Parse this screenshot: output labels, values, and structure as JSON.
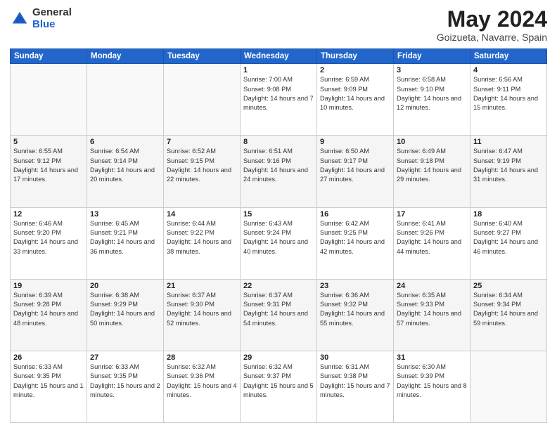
{
  "header": {
    "logo": {
      "general": "General",
      "blue": "Blue"
    },
    "title": "May 2024",
    "subtitle": "Goizueta, Navarre, Spain"
  },
  "weekdays": [
    "Sunday",
    "Monday",
    "Tuesday",
    "Wednesday",
    "Thursday",
    "Friday",
    "Saturday"
  ],
  "weeks": [
    [
      {
        "day": "",
        "empty": true
      },
      {
        "day": "",
        "empty": true
      },
      {
        "day": "",
        "empty": true
      },
      {
        "day": "1",
        "sunrise": "Sunrise: 7:00 AM",
        "sunset": "Sunset: 9:08 PM",
        "daylight": "Daylight: 14 hours and 7 minutes."
      },
      {
        "day": "2",
        "sunrise": "Sunrise: 6:59 AM",
        "sunset": "Sunset: 9:09 PM",
        "daylight": "Daylight: 14 hours and 10 minutes."
      },
      {
        "day": "3",
        "sunrise": "Sunrise: 6:58 AM",
        "sunset": "Sunset: 9:10 PM",
        "daylight": "Daylight: 14 hours and 12 minutes."
      },
      {
        "day": "4",
        "sunrise": "Sunrise: 6:56 AM",
        "sunset": "Sunset: 9:11 PM",
        "daylight": "Daylight: 14 hours and 15 minutes."
      }
    ],
    [
      {
        "day": "5",
        "sunrise": "Sunrise: 6:55 AM",
        "sunset": "Sunset: 9:12 PM",
        "daylight": "Daylight: 14 hours and 17 minutes."
      },
      {
        "day": "6",
        "sunrise": "Sunrise: 6:54 AM",
        "sunset": "Sunset: 9:14 PM",
        "daylight": "Daylight: 14 hours and 20 minutes."
      },
      {
        "day": "7",
        "sunrise": "Sunrise: 6:52 AM",
        "sunset": "Sunset: 9:15 PM",
        "daylight": "Daylight: 14 hours and 22 minutes."
      },
      {
        "day": "8",
        "sunrise": "Sunrise: 6:51 AM",
        "sunset": "Sunset: 9:16 PM",
        "daylight": "Daylight: 14 hours and 24 minutes."
      },
      {
        "day": "9",
        "sunrise": "Sunrise: 6:50 AM",
        "sunset": "Sunset: 9:17 PM",
        "daylight": "Daylight: 14 hours and 27 minutes."
      },
      {
        "day": "10",
        "sunrise": "Sunrise: 6:49 AM",
        "sunset": "Sunset: 9:18 PM",
        "daylight": "Daylight: 14 hours and 29 minutes."
      },
      {
        "day": "11",
        "sunrise": "Sunrise: 6:47 AM",
        "sunset": "Sunset: 9:19 PM",
        "daylight": "Daylight: 14 hours and 31 minutes."
      }
    ],
    [
      {
        "day": "12",
        "sunrise": "Sunrise: 6:46 AM",
        "sunset": "Sunset: 9:20 PM",
        "daylight": "Daylight: 14 hours and 33 minutes."
      },
      {
        "day": "13",
        "sunrise": "Sunrise: 6:45 AM",
        "sunset": "Sunset: 9:21 PM",
        "daylight": "Daylight: 14 hours and 36 minutes."
      },
      {
        "day": "14",
        "sunrise": "Sunrise: 6:44 AM",
        "sunset": "Sunset: 9:22 PM",
        "daylight": "Daylight: 14 hours and 38 minutes."
      },
      {
        "day": "15",
        "sunrise": "Sunrise: 6:43 AM",
        "sunset": "Sunset: 9:24 PM",
        "daylight": "Daylight: 14 hours and 40 minutes."
      },
      {
        "day": "16",
        "sunrise": "Sunrise: 6:42 AM",
        "sunset": "Sunset: 9:25 PM",
        "daylight": "Daylight: 14 hours and 42 minutes."
      },
      {
        "day": "17",
        "sunrise": "Sunrise: 6:41 AM",
        "sunset": "Sunset: 9:26 PM",
        "daylight": "Daylight: 14 hours and 44 minutes."
      },
      {
        "day": "18",
        "sunrise": "Sunrise: 6:40 AM",
        "sunset": "Sunset: 9:27 PM",
        "daylight": "Daylight: 14 hours and 46 minutes."
      }
    ],
    [
      {
        "day": "19",
        "sunrise": "Sunrise: 6:39 AM",
        "sunset": "Sunset: 9:28 PM",
        "daylight": "Daylight: 14 hours and 48 minutes."
      },
      {
        "day": "20",
        "sunrise": "Sunrise: 6:38 AM",
        "sunset": "Sunset: 9:29 PM",
        "daylight": "Daylight: 14 hours and 50 minutes."
      },
      {
        "day": "21",
        "sunrise": "Sunrise: 6:37 AM",
        "sunset": "Sunset: 9:30 PM",
        "daylight": "Daylight: 14 hours and 52 minutes."
      },
      {
        "day": "22",
        "sunrise": "Sunrise: 6:37 AM",
        "sunset": "Sunset: 9:31 PM",
        "daylight": "Daylight: 14 hours and 54 minutes."
      },
      {
        "day": "23",
        "sunrise": "Sunrise: 6:36 AM",
        "sunset": "Sunset: 9:32 PM",
        "daylight": "Daylight: 14 hours and 55 minutes."
      },
      {
        "day": "24",
        "sunrise": "Sunrise: 6:35 AM",
        "sunset": "Sunset: 9:33 PM",
        "daylight": "Daylight: 14 hours and 57 minutes."
      },
      {
        "day": "25",
        "sunrise": "Sunrise: 6:34 AM",
        "sunset": "Sunset: 9:34 PM",
        "daylight": "Daylight: 14 hours and 59 minutes."
      }
    ],
    [
      {
        "day": "26",
        "sunrise": "Sunrise: 6:33 AM",
        "sunset": "Sunset: 9:35 PM",
        "daylight": "Daylight: 15 hours and 1 minute."
      },
      {
        "day": "27",
        "sunrise": "Sunrise: 6:33 AM",
        "sunset": "Sunset: 9:35 PM",
        "daylight": "Daylight: 15 hours and 2 minutes."
      },
      {
        "day": "28",
        "sunrise": "Sunrise: 6:32 AM",
        "sunset": "Sunset: 9:36 PM",
        "daylight": "Daylight: 15 hours and 4 minutes."
      },
      {
        "day": "29",
        "sunrise": "Sunrise: 6:32 AM",
        "sunset": "Sunset: 9:37 PM",
        "daylight": "Daylight: 15 hours and 5 minutes."
      },
      {
        "day": "30",
        "sunrise": "Sunrise: 6:31 AM",
        "sunset": "Sunset: 9:38 PM",
        "daylight": "Daylight: 15 hours and 7 minutes."
      },
      {
        "day": "31",
        "sunrise": "Sunrise: 6:30 AM",
        "sunset": "Sunset: 9:39 PM",
        "daylight": "Daylight: 15 hours and 8 minutes."
      },
      {
        "day": "",
        "empty": true
      }
    ]
  ]
}
